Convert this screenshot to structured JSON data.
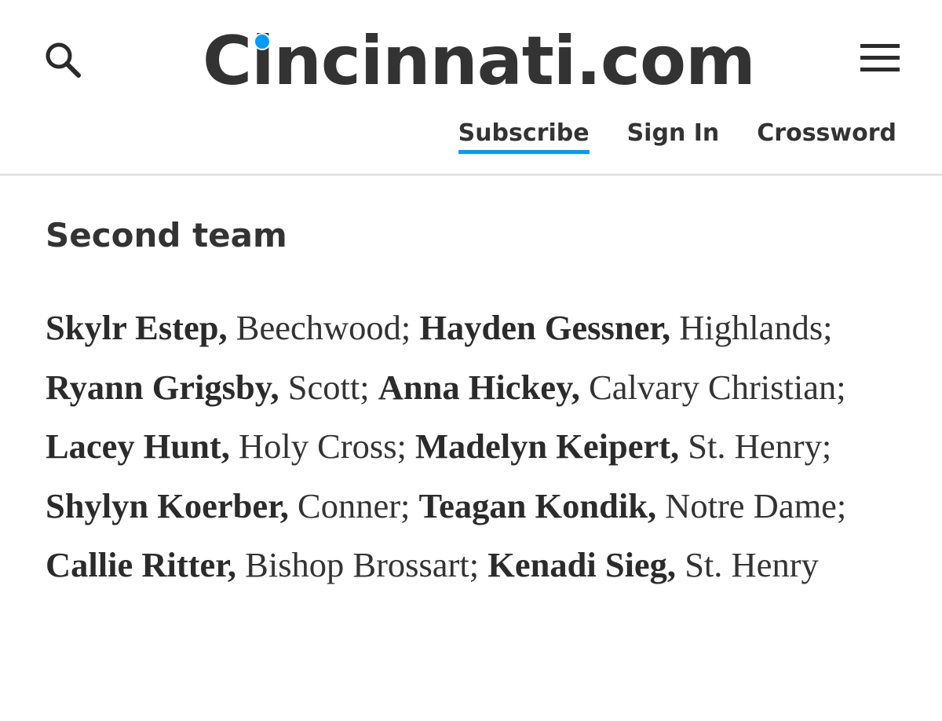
{
  "header": {
    "logo_text_before": "C",
    "logo_dotted_letter": "i",
    "logo_text_after": "ncinnati.com",
    "nav": {
      "subscribe_label": "Subscribe",
      "signin_label": "Sign In",
      "crossword_label": "Crossword"
    }
  },
  "colors": {
    "accent": "#009bff",
    "text": "#333333",
    "divider": "#e3e3e3"
  },
  "icons": {
    "search": "search-icon",
    "menu": "hamburger-menu-icon"
  },
  "article": {
    "section_title": "Second team",
    "roster": [
      {
        "name": "Skylr Estep,",
        "school": " Beechwood; "
      },
      {
        "name": "Hayden Gessner,",
        "school": " Highlands; "
      },
      {
        "name": "Ryann Grigsby,",
        "school": " Scott; "
      },
      {
        "name": "Anna Hickey,",
        "school": " Calvary Christian; "
      },
      {
        "name": "Lacey Hunt,",
        "school": " Holy Cross; "
      },
      {
        "name": "Madelyn Keipert,",
        "school": " St. Henry; "
      },
      {
        "name": "Shylyn Koerber,",
        "school": " Conner; "
      },
      {
        "name": "Teagan Kondik,",
        "school": " Notre Dame; "
      },
      {
        "name": "Callie Ritter,",
        "school": " Bishop Brossart; "
      },
      {
        "name": "Kenadi Sieg,",
        "school": " St. Henry"
      }
    ]
  }
}
